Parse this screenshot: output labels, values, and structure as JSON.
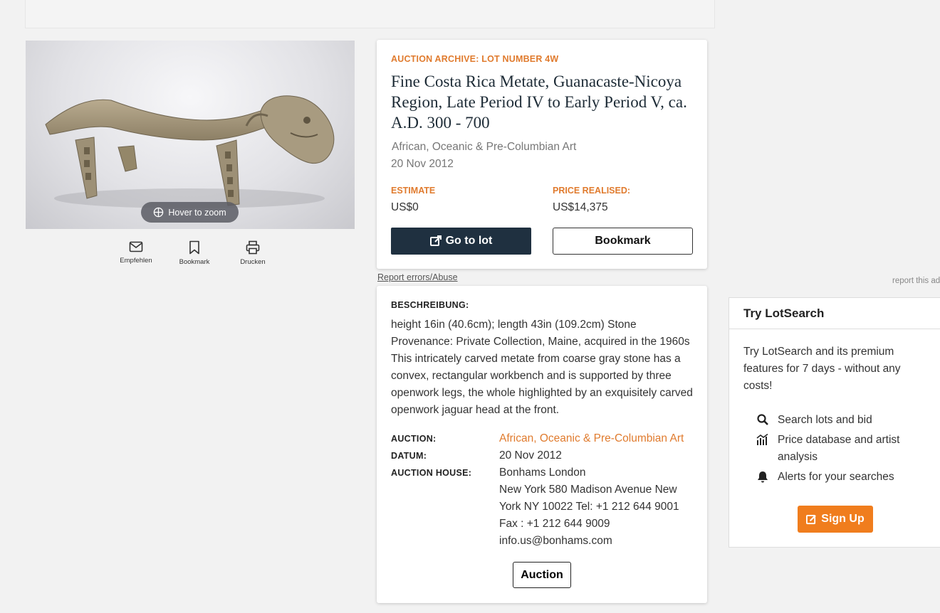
{
  "image": {
    "zoom_hint": "Hover to zoom"
  },
  "actions": [
    {
      "label": "Empfehlen",
      "icon": "mail-icon"
    },
    {
      "label": "Bookmark",
      "icon": "bookmark-icon"
    },
    {
      "label": "Drucken",
      "icon": "print-icon"
    }
  ],
  "lot": {
    "eyebrow": "AUCTION ARCHIVE: LOT NUMBER 4W",
    "title": "Fine Costa Rica Metate, Guanacaste-Nicoya Region, Late Period IV to Early Period V, ca. A.D. 300 - 700",
    "category": "African, Oceanic & Pre-Columbian Art",
    "date": "20 Nov 2012",
    "estimate_label": "ESTIMATE",
    "estimate_value": "US$0",
    "price_label": "PRICE REALISED:",
    "price_value": "US$14,375",
    "go_to_lot": "Go to lot",
    "bookmark": "Bookmark"
  },
  "report_link": "Report errors/Abuse",
  "description": {
    "heading": "BESCHREIBUNG:",
    "text": "height 16in (40.6cm); length 43in (109.2cm) Stone Provenance: Private Collection, Maine, acquired in the 1960s This intricately carved metate from coarse gray stone has a convex, rectangular workbench and is supported by three openwork legs, the whole highlighted by an exquisitely carved openwork jaguar head at the front."
  },
  "meta": {
    "auction_label": "AUCTION:",
    "auction_value": "African, Oceanic & Pre-Columbian Art",
    "date_label": "DATUM:",
    "date_value": "20 Nov 2012",
    "house_label": "AUCTION HOUSE:",
    "house_lines": [
      "Bonhams London",
      "New York 580 Madison Avenue New",
      "York NY 10022 Tel: +1 212 644 9001",
      "Fax : +1 212 644 9009",
      "info.us@bonhams.com"
    ],
    "auction_button": "Auction"
  },
  "report_ad": "report this ad",
  "lotsearch": {
    "title": "Try LotSearch",
    "text": "Try LotSearch and its premium features for 7 days - without any costs!",
    "features": [
      {
        "icon": "search-icon",
        "label": "Search lots and bid"
      },
      {
        "icon": "chart-icon",
        "label": "Price database and artist analysis"
      },
      {
        "icon": "bell-icon",
        "label": "Alerts for your searches"
      }
    ],
    "signup": "Sign Up"
  },
  "colors": {
    "accent": "#e07b2e",
    "dark_button": "#1f3040",
    "signup": "#f07d1d"
  }
}
